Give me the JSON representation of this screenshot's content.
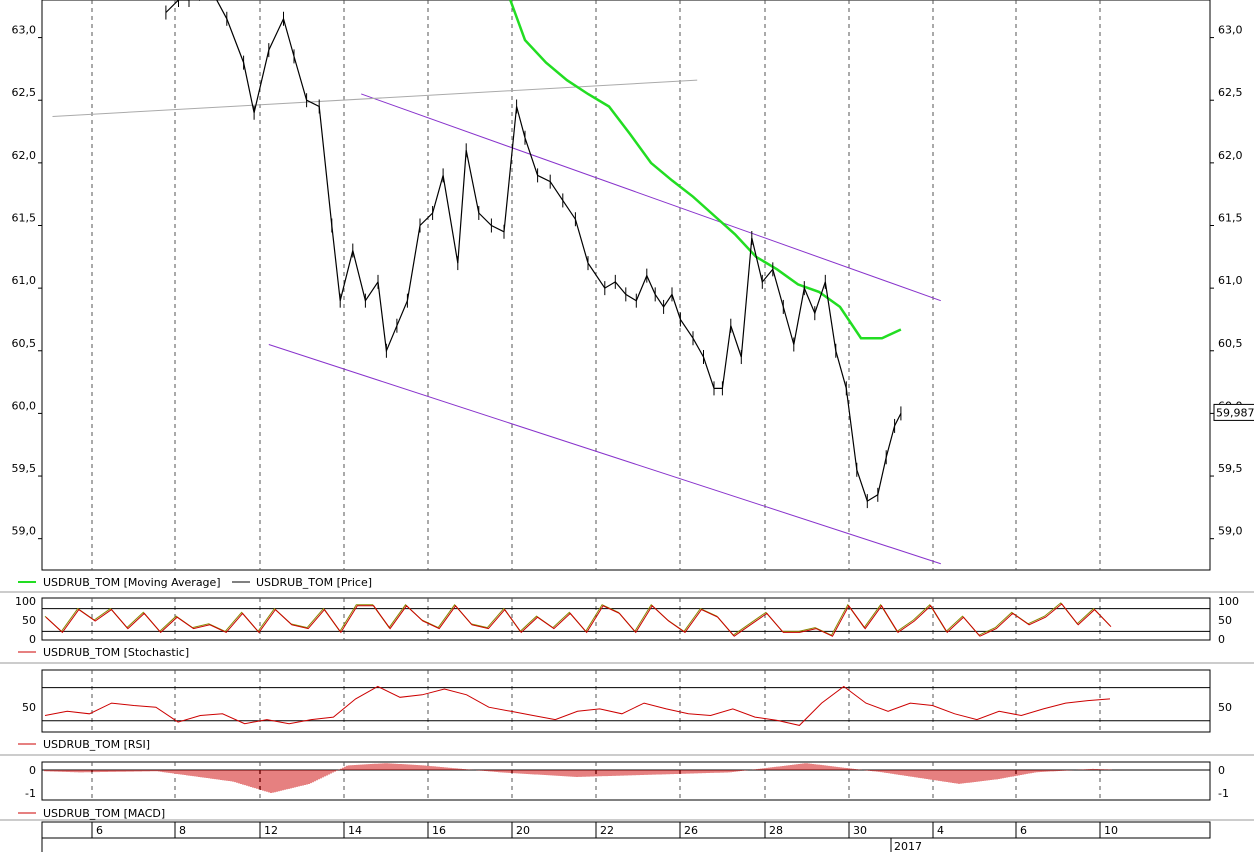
{
  "chart_data": {
    "type": "line",
    "main": {
      "ylim": [
        58.75,
        63.3
      ],
      "yticks": [
        "59,0",
        "59,5",
        "60,0",
        "60,5",
        "61,0",
        "61,5",
        "62,0",
        "62,5",
        "63,0"
      ],
      "last_price_label": "59,9875",
      "series": [
        {
          "name": "USDRUB_TOM [Moving Average]",
          "color": "#22dd22",
          "x": [
            22.3,
            23,
            24,
            25,
            26,
            27,
            28,
            29,
            30,
            31,
            32,
            33,
            34,
            35,
            36,
            37,
            38,
            39,
            40,
            40.9
          ],
          "y": [
            63.3,
            62.98,
            62.8,
            62.66,
            62.55,
            62.45,
            62.23,
            62.0,
            61.86,
            61.73,
            61.58,
            61.43,
            61.25,
            61.15,
            61.03,
            60.97,
            60.85,
            60.6,
            60.6,
            60.67
          ]
        },
        {
          "name": "USDRUB_TOM [Price]",
          "color": "#000000",
          "x": [
            5.9,
            6.5,
            7,
            7.5,
            8.0,
            8.8,
            9.6,
            10.1,
            10.8,
            11.5,
            12.0,
            12.6,
            13.2,
            13.8,
            14.2,
            14.8,
            15.4,
            16.0,
            16.4,
            16.9,
            17.4,
            18.0,
            18.6,
            19.1,
            19.8,
            20.2,
            20.8,
            21.4,
            22.0,
            22.6,
            23.0,
            23.6,
            24.2,
            24.8,
            25.4,
            26.0,
            26.8,
            27.3,
            27.8,
            28.3,
            28.8,
            29.2,
            29.6,
            30.0,
            30.4,
            31.0,
            31.5,
            32.0,
            32.4,
            32.8,
            33.3,
            33.8,
            34.3,
            34.8,
            35.3,
            35.8,
            36.3,
            36.8,
            37.3,
            37.8,
            38.3,
            38.8,
            39.3,
            39.8,
            40.2,
            40.6,
            40.9
          ],
          "y": [
            63.2,
            63.3,
            63.3,
            63.35,
            63.4,
            63.15,
            62.8,
            62.4,
            62.9,
            63.15,
            62.85,
            62.5,
            62.45,
            61.5,
            60.9,
            61.3,
            60.9,
            61.05,
            60.5,
            60.7,
            60.9,
            61.5,
            61.6,
            61.9,
            61.2,
            62.1,
            61.6,
            61.5,
            61.45,
            62.45,
            62.2,
            61.9,
            61.85,
            61.7,
            61.55,
            61.2,
            61.0,
            61.05,
            60.95,
            60.9,
            61.1,
            60.95,
            60.85,
            60.95,
            60.75,
            60.6,
            60.45,
            60.2,
            60.2,
            60.7,
            60.45,
            61.4,
            61.05,
            61.15,
            60.85,
            60.55,
            61.0,
            60.8,
            61.05,
            60.5,
            60.2,
            59.55,
            59.3,
            59.35,
            59.65,
            59.9,
            60.0
          ]
        }
      ],
      "trendlines": [
        {
          "color": "#8833cc",
          "x": [
            10.8,
            42.8
          ],
          "y": [
            60.55,
            58.8
          ]
        },
        {
          "color": "#8833cc",
          "x": [
            15.2,
            42.8
          ],
          "y": [
            62.55,
            60.9
          ]
        },
        {
          "color": "#aaaaaa",
          "x": [
            0.5,
            31.2
          ],
          "y": [
            62.37,
            62.66
          ]
        }
      ]
    },
    "stochastic": {
      "name": "USDRUB_TOM [Stochastic]",
      "color": "#cc0000",
      "ylim": [
        0,
        100
      ],
      "yticks": [
        "0",
        "50",
        "100"
      ],
      "values": [
        60,
        20,
        80,
        50,
        80,
        30,
        70,
        20,
        60,
        30,
        40,
        20,
        70,
        20,
        80,
        40,
        30,
        80,
        20,
        90,
        90,
        30,
        90,
        50,
        30,
        90,
        40,
        30,
        80,
        20,
        60,
        30,
        70,
        20,
        90,
        70,
        20,
        90,
        50,
        20,
        80,
        60,
        10,
        40,
        70,
        20,
        20,
        30,
        10,
        90,
        30,
        90,
        20,
        50,
        90,
        20,
        60,
        10,
        30,
        70,
        40,
        60,
        95,
        40,
        80,
        35
      ]
    },
    "rsi": {
      "name": "USDRUB_TOM [RSI]",
      "color": "#cc0000",
      "ylim": [
        20,
        95
      ],
      "yticks": [
        "50"
      ],
      "values": [
        40,
        45,
        42,
        55,
        52,
        50,
        32,
        40,
        42,
        30,
        35,
        30,
        35,
        38,
        60,
        75,
        62,
        65,
        72,
        65,
        50,
        45,
        40,
        35,
        45,
        48,
        42,
        55,
        48,
        42,
        40,
        48,
        38,
        34,
        28,
        55,
        75,
        55,
        45,
        55,
        52,
        42,
        35,
        45,
        40,
        48,
        55,
        58,
        60
      ]
    },
    "macd": {
      "name": "USDRUB_TOM [MACD]",
      "color": "#cc0000",
      "ylim": [
        -1.3,
        0.35
      ],
      "yticks": [
        "0",
        "-1"
      ]
    },
    "xaxis": {
      "ticks": [
        "6",
        "8",
        "12",
        "14",
        "16",
        "20",
        "22",
        "26",
        "28",
        "30",
        "4",
        "6",
        "10"
      ],
      "year_label": "2017"
    }
  }
}
